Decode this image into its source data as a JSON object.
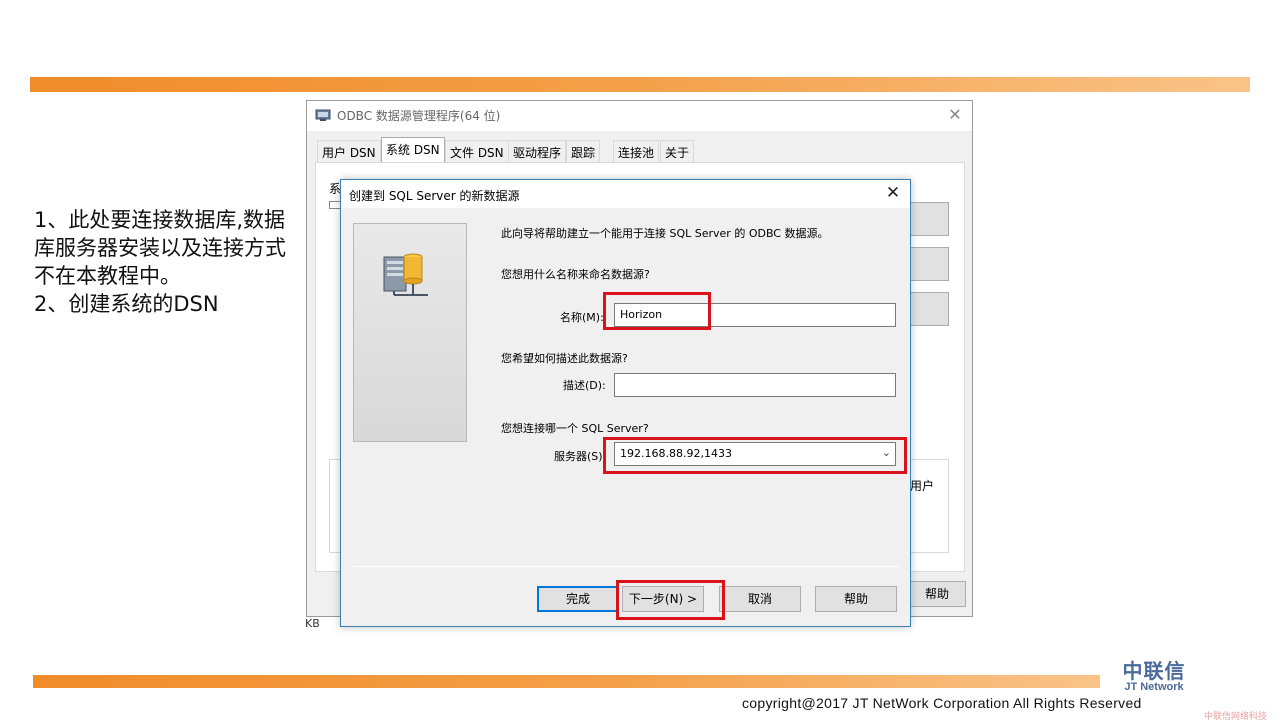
{
  "slide": {
    "instructions": [
      "1、此处要连接数据库,数据库服务器安装以及连接方式不在本教程中。",
      "2、创建系统的DSN"
    ],
    "copyright": "copyright@2017  JT NetWork Corporation All Rights Reserved",
    "logo_cn": "中联信",
    "logo_en": "JT Network",
    "watermark": "中联信网络科技",
    "accent_color": "#f08c2a"
  },
  "odbc_window": {
    "title": "ODBC 数据源管理程序(64 位)",
    "tabs": [
      "用户 DSN",
      "系统 DSN",
      "文件 DSN",
      "驱动程序",
      "跟踪",
      "连接池",
      "关于"
    ],
    "active_tab": "系统 DSN",
    "partial_label": "系",
    "partial_info": "用户",
    "help_button": "帮助",
    "footer_partial": "KB"
  },
  "dialog": {
    "title": "创建到 SQL Server 的新数据源",
    "intro": "此向导将帮助建立一个能用于连接 SQL Server 的 ODBC 数据源。",
    "name_question": "您想用什么名称来命名数据源?",
    "name_label": "名称(M):",
    "name_value": "Horizon",
    "desc_question": "您希望如何描述此数据源?",
    "desc_label": "描述(D):",
    "desc_value": "",
    "server_question": "您想连接哪一个 SQL Server?",
    "server_label": "服务器(S):",
    "server_value": "192.168.88.92,1433",
    "buttons": {
      "finish": "完成",
      "next": "下一步(N) >",
      "cancel": "取消",
      "help": "帮助"
    },
    "highlight_color": "#d9131b"
  }
}
